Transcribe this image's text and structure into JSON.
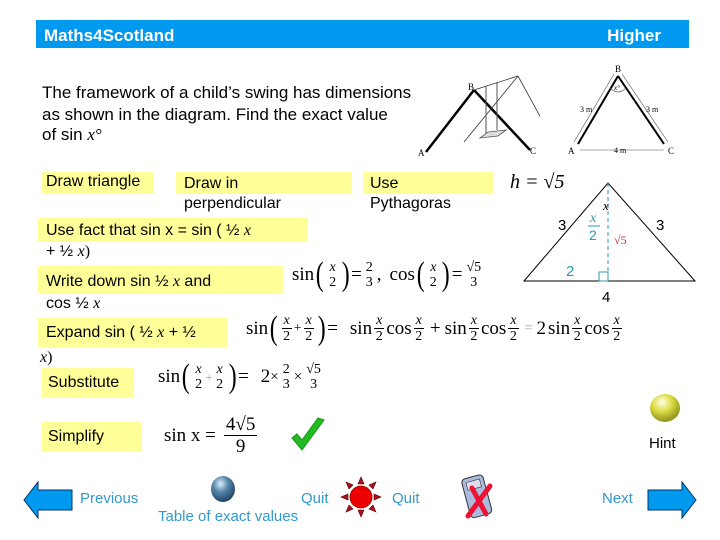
{
  "header": {
    "brand": "Maths4Scotland",
    "level": "Higher",
    "color": "#0099f0"
  },
  "question": {
    "line1": "The framework of a child’s swing has dimensions",
    "line2": "as shown in the diagram. Find the exact value",
    "line3_prefix": "of  sin ",
    "line3_var": "x°"
  },
  "swing_diagram": {
    "left_labels": {
      "A": "A",
      "B": "B",
      "C": "C"
    },
    "right_labels": {
      "A": "A",
      "B": "B",
      "C": "C",
      "side_ab": "3 m",
      "side_bc": "3 m",
      "base": "4 m",
      "angle": "x°"
    }
  },
  "triangle_diagram": {
    "h_label": "h = √5",
    "left_side": "3",
    "right_side": "3",
    "apex_angle": "x",
    "half_angle_num": "x",
    "half_angle_den": "2",
    "height": "√5",
    "half_base": "2",
    "base": "4"
  },
  "steps": [
    {
      "label": "Draw triangle"
    },
    {
      "label_line1": "Draw in",
      "label_line2": "perpendicular"
    },
    {
      "label_line1": "Use",
      "label_line2": "Pythagoras"
    },
    {
      "label_prefix": "Use fact that  sin x = sin ( ½ ",
      "label_var1": "x",
      "label_line2_prefix": "+ ½ ",
      "label_var2": "x",
      "label_line2_suffix": ")"
    },
    {
      "label_prefix": "Write down sin ½ ",
      "label_var1": "x",
      "label_mid": "  and",
      "label_line2_prefix": "cos ½ ",
      "label_var2": "x"
    },
    {
      "label_prefix": "Expand  sin ( ½ ",
      "label_var1": "x",
      "label_mid": " + ½",
      "label_var2": "x",
      "label_suffix": ")"
    },
    {
      "label": "Substitute"
    },
    {
      "label": "Simplify"
    }
  ],
  "math": {
    "halfangle": {
      "sin": "sin",
      "cos": "cos",
      "x": "x",
      "two": "2",
      "sin_num": "2",
      "sin_den": "3",
      "cos_num": "√5",
      "cos_den": "3",
      "eq": "=",
      "comma": ","
    },
    "expand": {
      "lhs": "sin",
      "x": "x",
      "two": "2",
      "plus": "+",
      "eq": "=",
      "t1a": "sin",
      "t1b": "cos",
      "t2a": "sin",
      "t2b": "cos",
      "eq2": "=",
      "coef": "2",
      "t3a": "sin",
      "t3b": "cos"
    },
    "substitute": {
      "lhs": "sin",
      "x": "x",
      "two": "2",
      "plus": "+",
      "eq": "=",
      "coef": "2",
      "times": "×",
      "f1_num": "2",
      "f1_den": "3",
      "f2_num": "√5",
      "f2_den": "3"
    },
    "simplify": {
      "lhs": "sin x =",
      "num": "4√5",
      "den": "9"
    }
  },
  "hint": {
    "label": "Hint"
  },
  "nav": {
    "previous": "Previous",
    "table_of_exact_values": "Table of exact values",
    "quit_left": "Quit",
    "quit_right": "Quit",
    "next": "Next"
  },
  "colors": {
    "highlight": "#ffff99",
    "nav_text": "#3399cc",
    "arrow": "#0099f0",
    "check": "#22bb22",
    "quit_sun": "#ee0000"
  }
}
